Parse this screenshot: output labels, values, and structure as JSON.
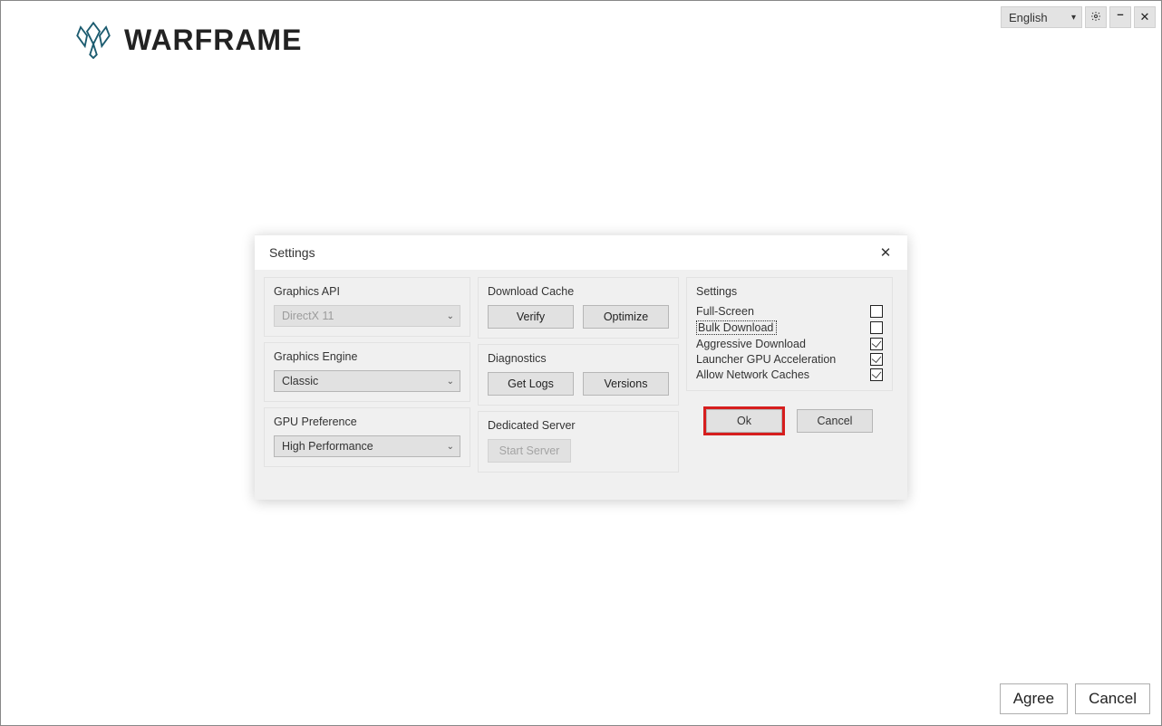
{
  "brand": "WARFRAME",
  "topbar": {
    "language": "English"
  },
  "footer": {
    "agree": "Agree",
    "cancel": "Cancel"
  },
  "dialog": {
    "title": "Settings",
    "graphics_api": {
      "label": "Graphics API",
      "value": "DirectX 11"
    },
    "graphics_engine": {
      "label": "Graphics Engine",
      "value": "Classic"
    },
    "gpu_pref": {
      "label": "GPU Preference",
      "value": "High Performance"
    },
    "download_cache": {
      "label": "Download Cache",
      "verify": "Verify",
      "optimize": "Optimize"
    },
    "diagnostics": {
      "label": "Diagnostics",
      "getlogs": "Get Logs",
      "versions": "Versions"
    },
    "dedicated": {
      "label": "Dedicated Server",
      "start": "Start Server"
    },
    "settings_group": {
      "label": "Settings",
      "items": [
        {
          "label": "Full-Screen",
          "checked": false,
          "boxed": false
        },
        {
          "label": "Bulk Download",
          "checked": false,
          "boxed": true
        },
        {
          "label": "Aggressive Download",
          "checked": true,
          "boxed": false
        },
        {
          "label": "Launcher GPU Acceleration",
          "checked": true,
          "boxed": false
        },
        {
          "label": "Allow Network Caches",
          "checked": true,
          "boxed": false
        }
      ]
    },
    "ok": "Ok",
    "cancel": "Cancel"
  }
}
